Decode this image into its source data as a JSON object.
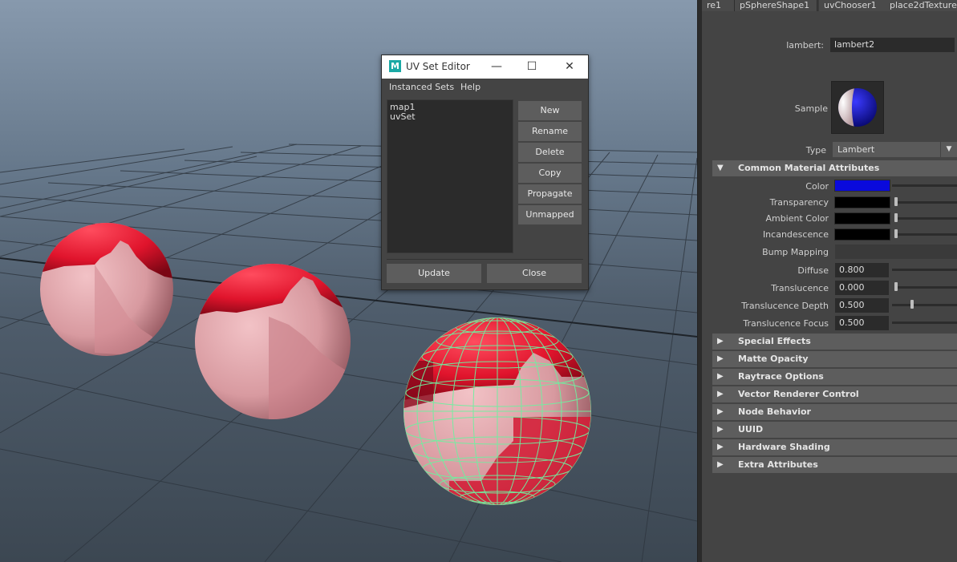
{
  "attribute_editor": {
    "tabs": [
      "re1",
      "pSphereShape1",
      "uvChooser1",
      "place2dTexture"
    ],
    "lambert_label": "lambert:",
    "lambert_value": "lambert2",
    "sample_label": "Sample",
    "type_label": "Type",
    "type_value": "Lambert",
    "common_section": "Common Material Attributes",
    "color_label": "Color",
    "transparency_label": "Transparency",
    "ambient_label": "Ambient Color",
    "incandescence_label": "Incandescence",
    "bump_label": "Bump Mapping",
    "diffuse_label": "Diffuse",
    "diffuse_value": "0.800",
    "translucence_label": "Translucence",
    "translucence_value": "0.000",
    "translucence_depth_label": "Translucence Depth",
    "translucence_depth_value": "0.500",
    "translucence_focus_label": "Translucence Focus",
    "translucence_focus_value": "0.500",
    "collapsed_sections": [
      "Special Effects",
      "Matte Opacity",
      "Raytrace Options",
      "Vector Renderer Control",
      "Node Behavior",
      "UUID",
      "Hardware Shading",
      "Extra Attributes"
    ],
    "colors": {
      "color": "#0a0adc",
      "transparency": "#000000",
      "ambient": "#000000",
      "incandescence": "#000000"
    }
  },
  "uv_set_editor": {
    "title": "UV Set Editor",
    "menus": [
      "Instanced Sets",
      "Help"
    ],
    "uv_sets": [
      "map1",
      "uvSet"
    ],
    "buttons": [
      "New",
      "Rename",
      "Delete",
      "Copy",
      "Propagate",
      "Unmapped"
    ],
    "update_label": "Update",
    "close_label": "Close",
    "minimize_glyph": "—",
    "maximize_glyph": "☐",
    "close_glyph": "✕",
    "logo_letter": "M"
  },
  "icons": {
    "expanded_arrow": "▼",
    "collapsed_arrow": "▶",
    "dropdown_arrow": "▼"
  }
}
